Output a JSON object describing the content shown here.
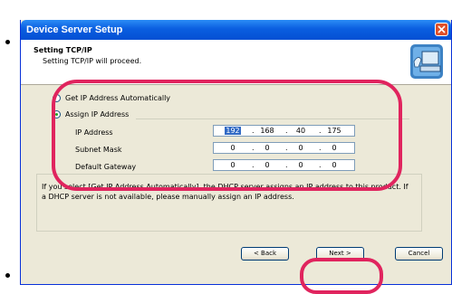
{
  "window": {
    "title": "Device Server Setup"
  },
  "header": {
    "title": "Setting TCP/IP",
    "subtitle": "Setting TCP/IP will proceed."
  },
  "options": {
    "auto_label": "Get IP Address Automatically",
    "assign_label": "Assign IP Address",
    "selected": "assign"
  },
  "fields": [
    {
      "label": "IP Address",
      "octets": [
        "192",
        "168",
        "40",
        "175"
      ]
    },
    {
      "label": "Subnet Mask",
      "octets": [
        "0",
        "0",
        "0",
        "0"
      ]
    },
    {
      "label": "Default Gateway",
      "octets": [
        "0",
        "0",
        "0",
        "0"
      ]
    }
  ],
  "note": {
    "text": "If you select [Get IP Address Automatically], the DHCP server assigns an IP address to this product. If a DHCP server is not available, please manually assign an IP address."
  },
  "buttons": {
    "back": "< Back",
    "next": "Next >",
    "cancel": "Cancel"
  },
  "colors": {
    "highlight_circle": "#e0245e",
    "titlebar": "#0a5ee0"
  }
}
